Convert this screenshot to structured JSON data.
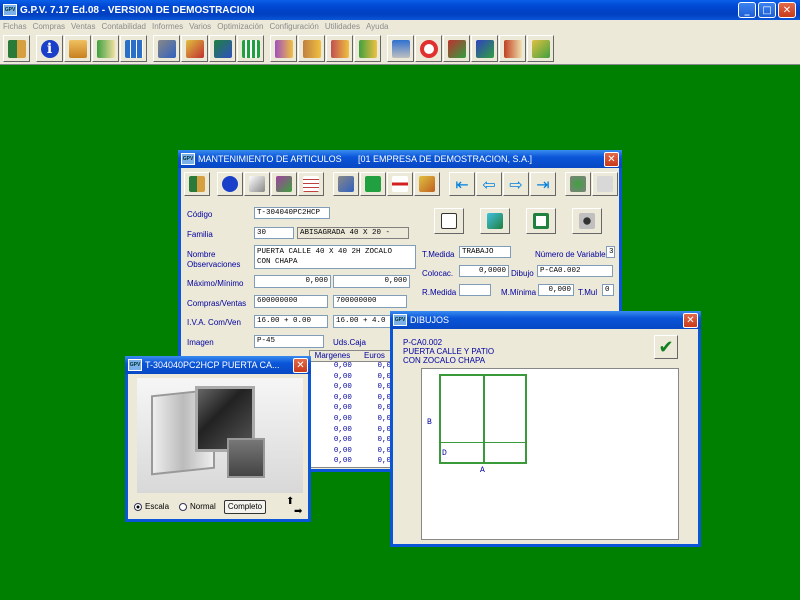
{
  "app": {
    "title": "G.P.V.  7.17  Ed.08  -  VERSION DE DEMOSTRACION",
    "icon_text": "GPV"
  },
  "menu": [
    "Fichas",
    "Compras",
    "Ventas",
    "Contabilidad",
    "Informes",
    "Varios",
    "Optimización",
    "Configuración",
    "Utilidades",
    "Ayuda"
  ],
  "toolbar_icons": [
    "exit-icon",
    "info-icon",
    "clients-icon",
    "suppliers-icon",
    "grid-icon",
    "tools-icon",
    "paint-icon",
    "users-icon",
    "chart-icon",
    "doc1-icon",
    "doc2-icon",
    "doc3-icon",
    "doc4-icon",
    "monitor-icon",
    "lifebuoy-icon",
    "map1-icon",
    "map2-icon",
    "book-icon",
    "check-icon"
  ],
  "articles": {
    "title": "MANTENIMIENTO DE ARTICULOS",
    "company": "[01  EMPRESA DE DEMOSTRACION, S.A.]",
    "labels": {
      "codigo": "Código",
      "familia": "Familia",
      "nombre": "Nombre",
      "observaciones": "Observaciones",
      "maxmin": "Máximo/Mínimo",
      "compras": "Compras/Ventas",
      "iva": "I.V.A. Com/Ven",
      "imagen": "Imagen",
      "uds_caja": "Uds.Caja",
      "t_medida": "T.Medida",
      "num_vars": "Número de Variables",
      "colocac": "Colocac.",
      "dibujo": "Dibujo",
      "r_medida": "R.Medida",
      "m_minima": "M.Mínima",
      "t_mul": "T.Mul"
    },
    "values": {
      "codigo": "T-304040PC2HCP",
      "familia_code": "30",
      "familia_name": "ABISAGRADA 40 X 20 -",
      "nombre": "PUERTA CALLE 40 X 40 2H ZOCALO\nCON CHAPA",
      "maximo": "0,000",
      "minimo": "0,000",
      "compras": "600000000",
      "ventas": "700000000",
      "iva_com": "16.00 +  0.00",
      "iva_ven": "16.00 +  4.0",
      "imagen": "P-45",
      "t_medida": "TRABAJO",
      "num_vars": "3",
      "colocac": "0,0000",
      "dibujo": "P-CA0.002",
      "m_minima": "0,000",
      "t_mul": "0"
    },
    "table": {
      "headers": [
        "Margenes",
        "Euros"
      ],
      "rows": [
        [
          "0,00",
          "0,0"
        ],
        [
          "0,00",
          "0,0"
        ],
        [
          "0,00",
          "0,0"
        ],
        [
          "0,00",
          "0,0"
        ],
        [
          "0,00",
          "0,0"
        ],
        [
          "0,00",
          "0,0"
        ],
        [
          "0,00",
          "0,0"
        ],
        [
          "0,00",
          "0,0"
        ],
        [
          "0,00",
          "0,0"
        ],
        [
          "0,00",
          "0,0"
        ]
      ]
    }
  },
  "photo": {
    "title": "T-304040PC2HCP   PUERTA CA...",
    "radio_escala": "Escala",
    "radio_normal": "Normal",
    "button": "Completo"
  },
  "dibujos": {
    "title": "DIBUJOS",
    "code": "P-CA0.002",
    "line1": "PUERTA CALLE Y PATIO",
    "line2": "CON ZOCALO CHAPA",
    "label_b": "B",
    "label_d": "D",
    "label_a": "A"
  }
}
